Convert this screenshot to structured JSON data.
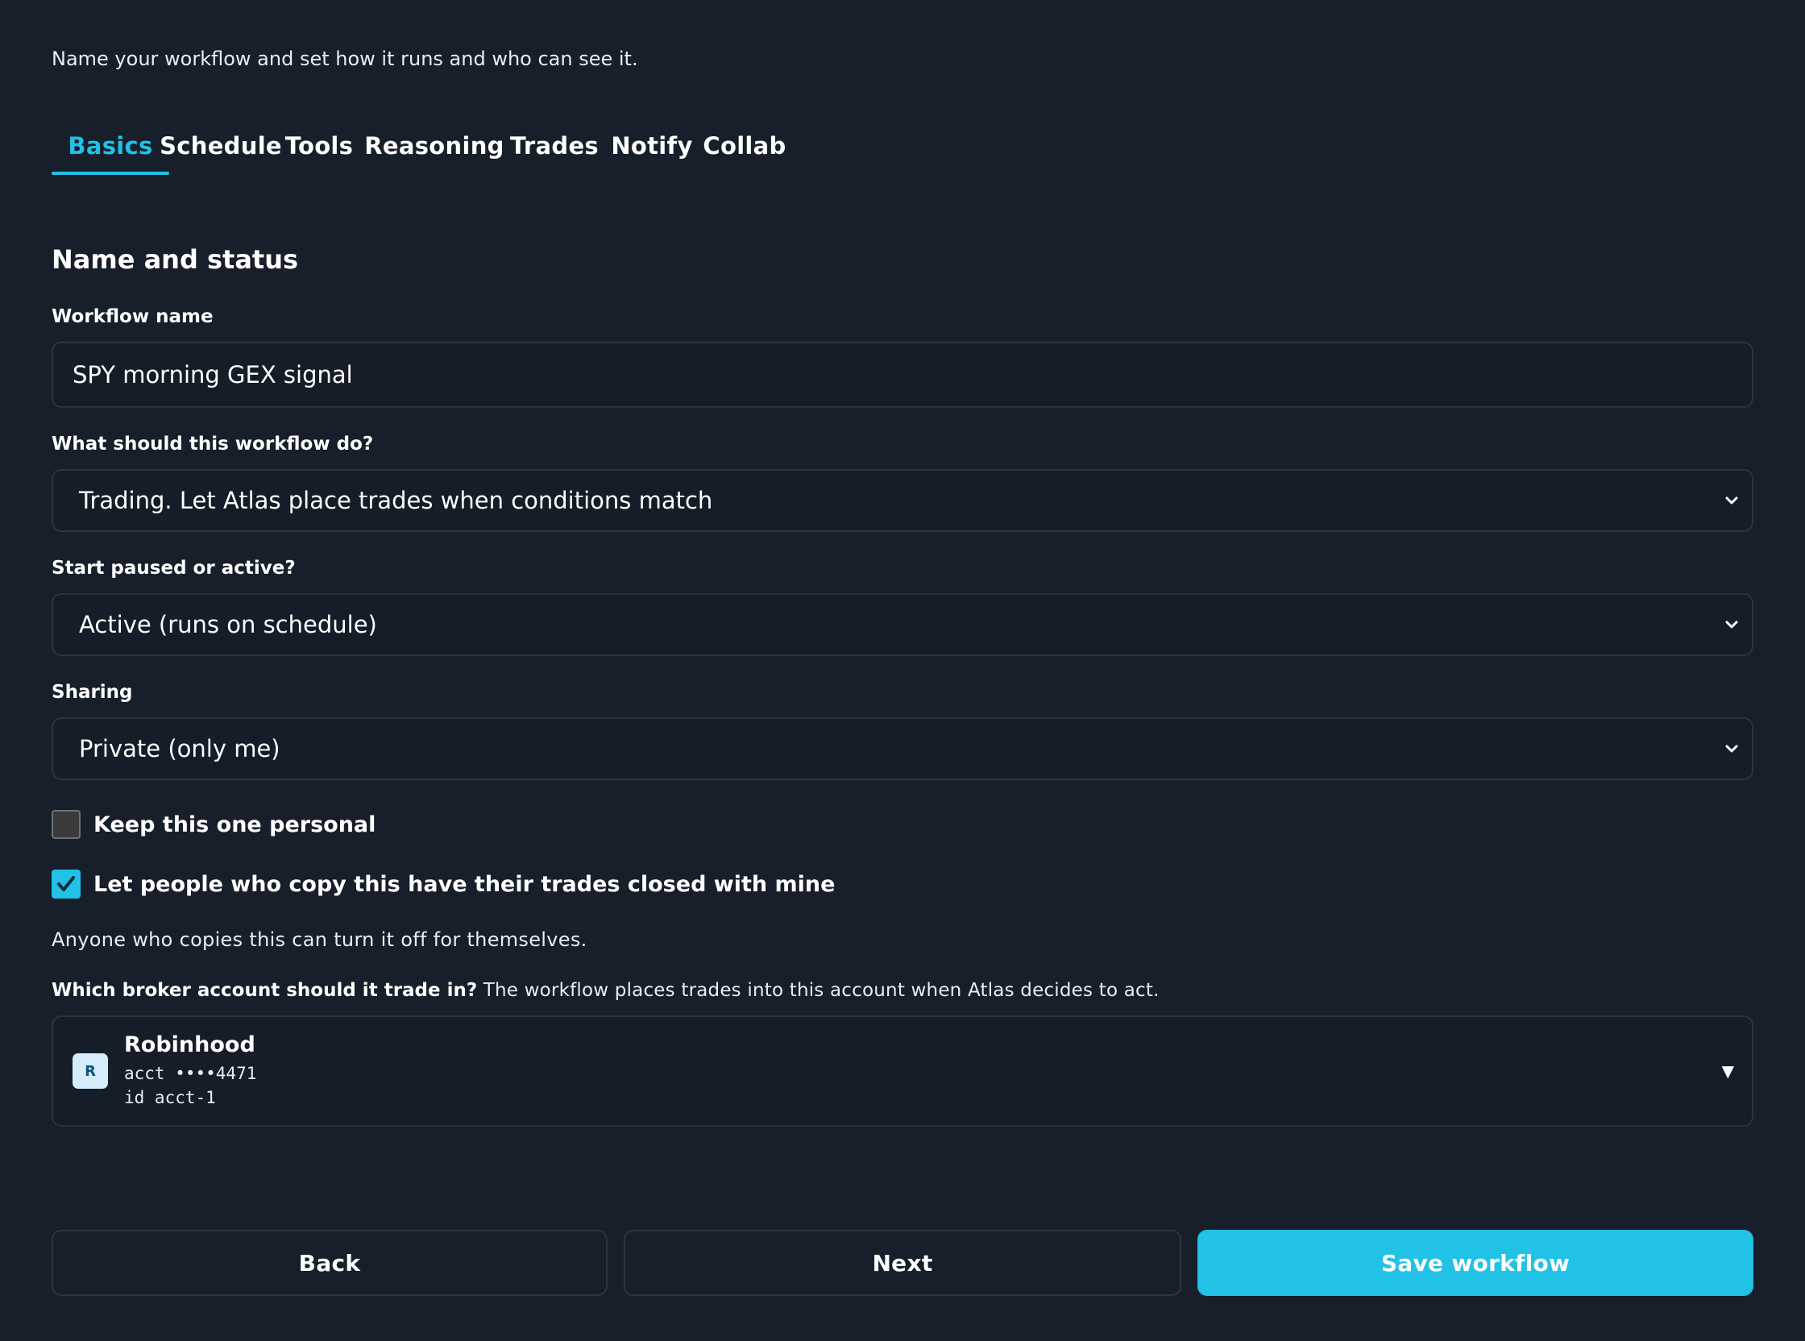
{
  "header": {
    "subtitle": "Name your workflow and set how it runs and who can see it."
  },
  "tabs": [
    {
      "label": "Basics",
      "active": true
    },
    {
      "label": "Schedule",
      "active": false
    },
    {
      "label": "Tools",
      "active": false
    },
    {
      "label": "Reasoning",
      "active": false
    },
    {
      "label": "Trades",
      "active": false
    },
    {
      "label": "Notify",
      "active": false
    },
    {
      "label": "Collab",
      "active": false
    }
  ],
  "section": {
    "title": "Name and status"
  },
  "workflow_name": {
    "label": "Workflow name",
    "value": "SPY morning GEX signal"
  },
  "purpose": {
    "label": "What should this workflow do?",
    "selected": "Trading. Let Atlas place trades when conditions match"
  },
  "start_state": {
    "label": "Start paused or active?",
    "selected": "Active (runs on schedule)"
  },
  "sharing": {
    "label": "Sharing",
    "selected": "Private (only me)"
  },
  "options": {
    "keep_personal": {
      "label": "Keep this one personal",
      "checked": false
    },
    "close_with_mine": {
      "label": "Let people who copy this have their trades closed with mine",
      "checked": true
    },
    "note": "Anyone who copies this can turn it off for themselves."
  },
  "broker": {
    "label_bold": "Which broker account should it trade in?",
    "label_desc": " The workflow places trades into this account when Atlas decides to act.",
    "avatar_letter": "R",
    "name": "Robinhood",
    "account": "acct ••••4471",
    "id": "id acct-1",
    "caret_icon": "caret-down-icon"
  },
  "footer": {
    "back_label": "Back",
    "next_label": "Next",
    "save_label": "Save workflow"
  },
  "colors": {
    "background": "#161f2a",
    "accent": "#22c1e6",
    "border": "#2a3441"
  }
}
